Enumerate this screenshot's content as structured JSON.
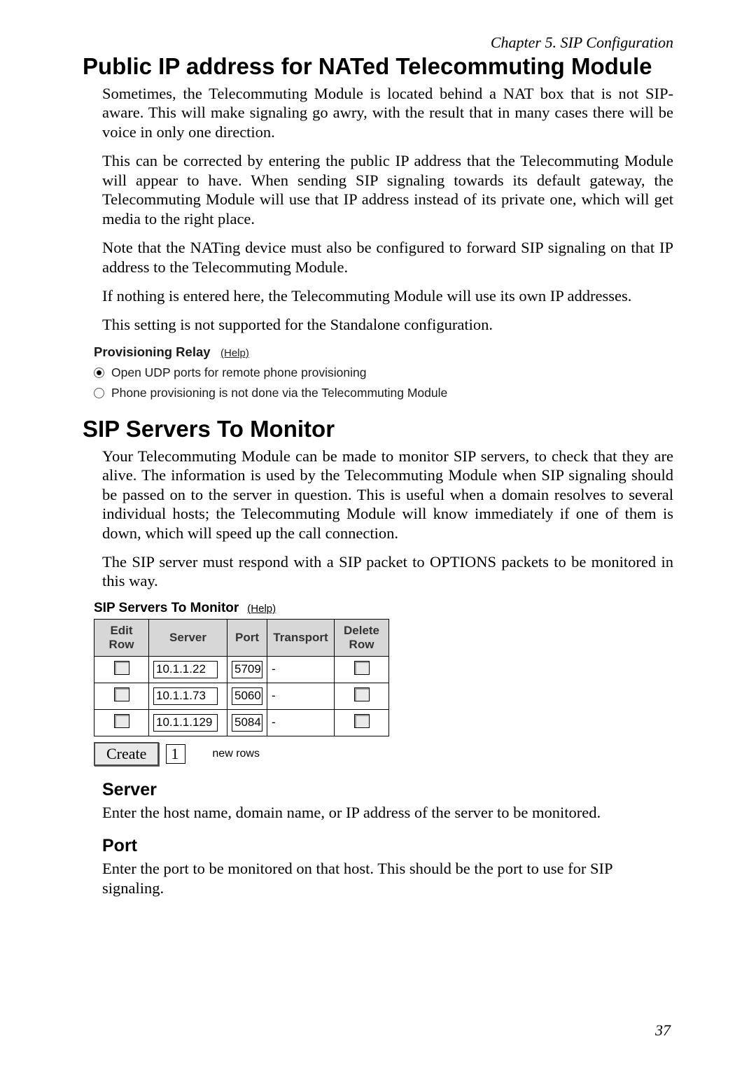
{
  "chapter": "Chapter 5. SIP Configuration",
  "page_number": "37",
  "section1": {
    "title": "Public IP address for NATed Telecommuting Module",
    "p1": "Sometimes, the Telecommuting Module is located behind a NAT box that is not SIP-aware. This will make signaling go awry, with the result that in many cases there will be voice in only one direction.",
    "p2": "This can be corrected by entering the public IP address that the Telecommuting Module will appear to have. When sending SIP signaling towards its default gateway, the Telecommuting Module will use that IP address instead of its private one, which will get media to the right place.",
    "p3": "Note that the NATing device must also be configured to forward SIP signaling on that IP address to the Telecommuting Module.",
    "p4": "If nothing is entered here, the Telecommuting Module will use its own IP addresses.",
    "p5": "This setting is not supported for the Standalone configuration."
  },
  "prov": {
    "title": "Provisioning Relay",
    "help": "(Help)",
    "opt1": "Open UDP ports for remote phone provisioning",
    "opt2": "Phone provisioning is not done via the Telecommuting Module",
    "selected_index": 0
  },
  "section2": {
    "title": "SIP Servers To Monitor",
    "p1": "Your Telecommuting Module can be made to monitor SIP servers, to check that they are alive. The information is used by the Telecommuting Module when SIP signaling should be passed on to the server in question. This is useful when a domain resolves to several individual hosts; the Telecommuting Module will know immediately if one of them is down, which will speed up the call connection.",
    "p2": "The SIP server must respond with a SIP packet to OPTIONS packets to be monitored in this way."
  },
  "widget": {
    "title": "SIP Servers To Monitor",
    "help": "(Help)",
    "headers": {
      "edit": "Edit Row",
      "server": "Server",
      "port": "Port",
      "transport": "Transport",
      "delete": "Delete Row"
    },
    "rows": [
      {
        "server": "10.1.1.22",
        "port": "5709",
        "transport": "-"
      },
      {
        "server": "10.1.1.73",
        "port": "5060",
        "transport": "-"
      },
      {
        "server": "10.1.1.129",
        "port": "5084",
        "transport": "-"
      }
    ],
    "create_label": "Create",
    "create_value": "1",
    "create_suffix": "new rows"
  },
  "section3": {
    "server_h": "Server",
    "server_p": "Enter the host name, domain name, or IP address of the server to be monitored.",
    "port_h": "Port",
    "port_p": "Enter the port to be monitored on that host. This should be the port to use for SIP signaling."
  }
}
